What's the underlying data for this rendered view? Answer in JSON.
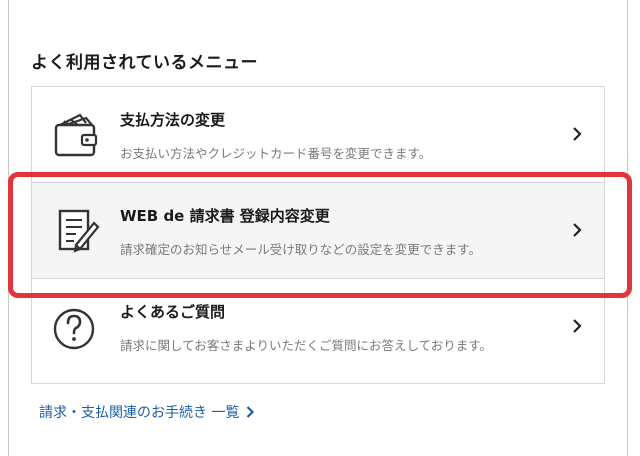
{
  "section": {
    "title": "よく利用されているメニュー"
  },
  "menu": {
    "items": [
      {
        "title": "支払方法の変更",
        "desc": "お支払い方法やクレジットカード番号を変更できます。",
        "icon": "wallet-icon"
      },
      {
        "title": "WEB de 請求書 登録内容変更",
        "desc": "請求確定のお知らせメール受け取りなどの設定を変更できます。",
        "icon": "document-edit-icon"
      },
      {
        "title": "よくあるご質問",
        "desc": "請求に関してお客さまよりいただくご質問にお答えしております。",
        "icon": "question-circle-icon"
      }
    ]
  },
  "footer": {
    "link": "請求・支払関連のお手続き 一覧"
  },
  "colors": {
    "highlight": "#e0353a",
    "link": "#1b5ea6"
  }
}
